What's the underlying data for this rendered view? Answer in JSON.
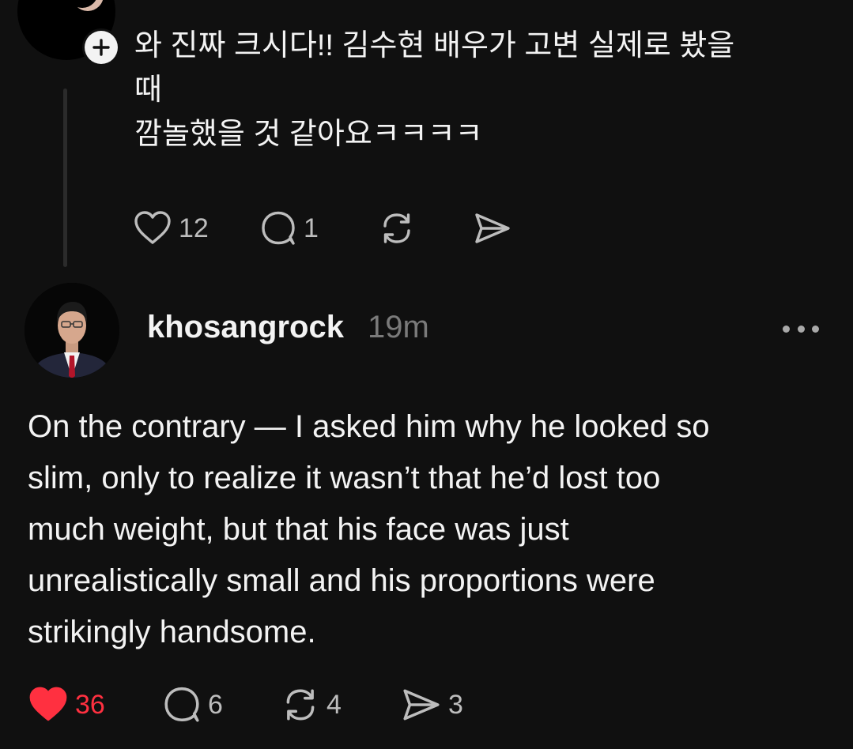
{
  "reply_post": {
    "text_lines": [
      "와 진짜 크시다!! 김수현 배우가 고변 실제로 봤을",
      "때",
      "깜놀했을 것 같아요ㅋㅋㅋㅋ"
    ],
    "like_count": "12",
    "reply_count": "1",
    "icons": {
      "like": "heart-outline-icon",
      "reply": "comment-bubble-icon",
      "repost": "repost-arrows-icon",
      "share": "send-arrow-icon",
      "follow": "plus-icon"
    }
  },
  "main_post": {
    "username": "khosangrock",
    "timestamp": "19m",
    "text_lines": [
      "On the contrary — I asked him why he looked so",
      "slim, only to realize it wasn’t that he’d lost too",
      "much weight, but that his face was just",
      "unrealistically small and his proportions were",
      "strikingly handsome."
    ],
    "like_count": "36",
    "reply_count": "6",
    "repost_count": "4",
    "share_count": "3",
    "liked": true,
    "icons": {
      "like": "heart-filled-icon",
      "reply": "comment-bubble-icon",
      "repost": "repost-arrows-icon",
      "share": "send-arrow-icon",
      "more": "more-dots-icon"
    }
  },
  "colors": {
    "background": "#101010",
    "text": "#f3f3f3",
    "muted": "#7a7a7a",
    "like_active": "#ff3040"
  }
}
